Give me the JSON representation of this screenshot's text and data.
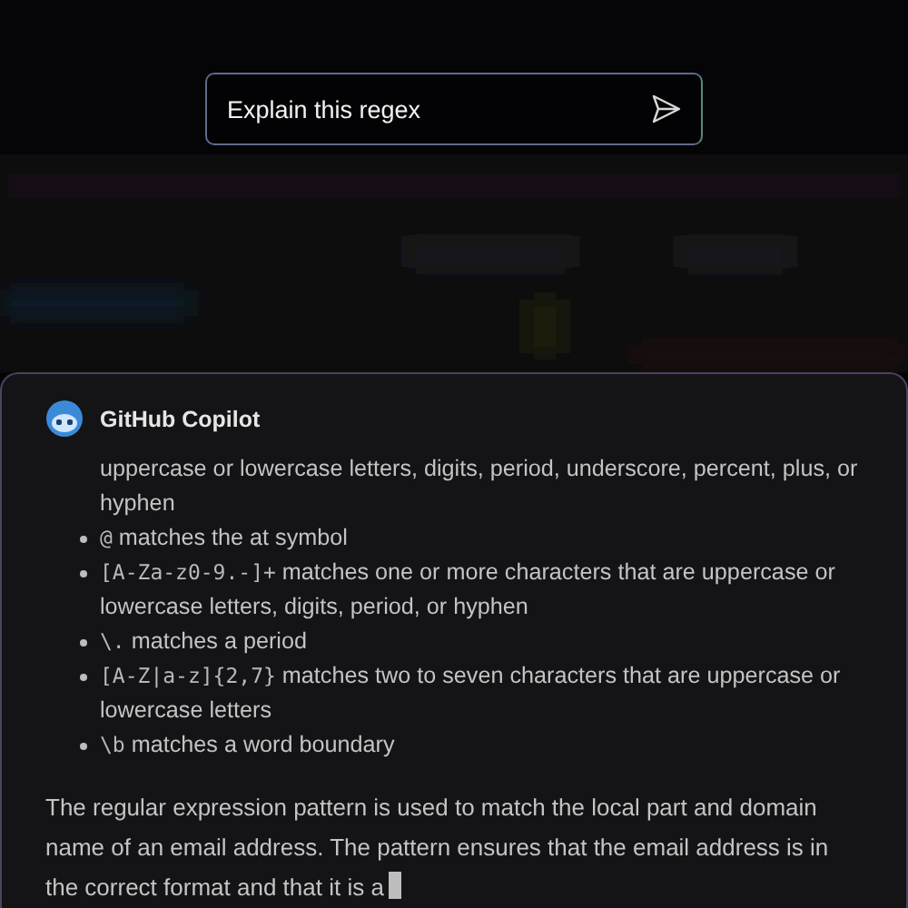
{
  "prompt": {
    "value": "Explain this regex"
  },
  "response": {
    "author": "GitHub Copilot",
    "items": [
      {
        "kind": "continuation",
        "text": "uppercase or lowercase letters, digits, period, underscore, percent, plus, or hyphen"
      },
      {
        "kind": "bullet",
        "code": "@",
        "text": " matches the at symbol"
      },
      {
        "kind": "bullet",
        "code": "[A-Za-z0-9.-]+",
        "text": " matches one or more characters that are uppercase or lowercase letters, digits, period, or hyphen"
      },
      {
        "kind": "bullet",
        "code": "\\.",
        "text": " matches a period"
      },
      {
        "kind": "bullet",
        "code": "[A-Z|a-z]{2,7}",
        "text": " matches two to seven characters that are uppercase or lowercase letters"
      },
      {
        "kind": "bullet",
        "code": "\\b",
        "text": " matches a word boundary"
      }
    ],
    "summary": "The regular expression pattern is used to match the local part and domain name of an email address. The pattern ensures that the email address is in the correct format and that it is a",
    "streaming": true
  }
}
